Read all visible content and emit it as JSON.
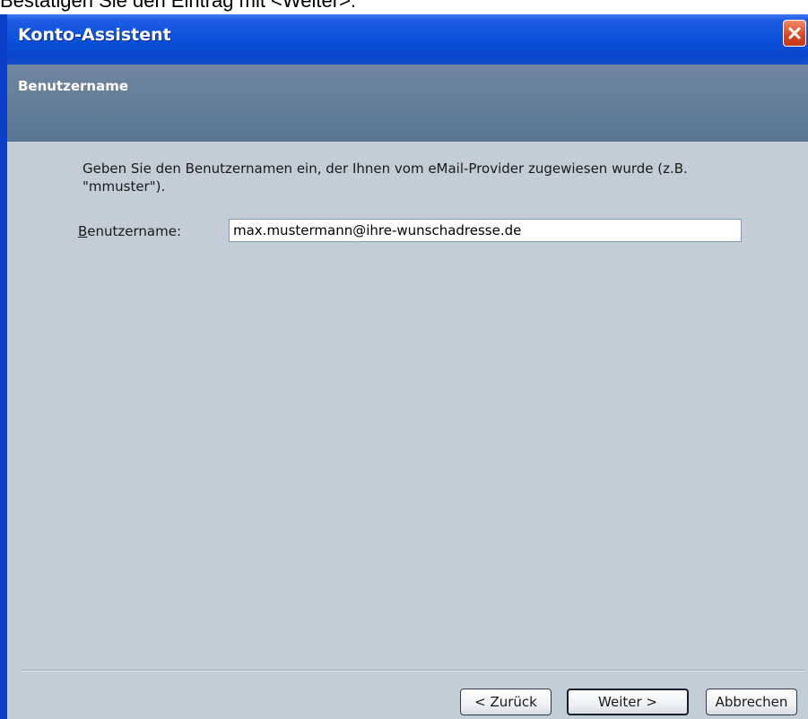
{
  "caption": "Bestätigen Sie den Eintrag mit <Weiter>.",
  "window": {
    "title": "Konto-Assistent"
  },
  "header": {
    "title": "Benutzername"
  },
  "content": {
    "description": "Geben Sie den Benutzernamen ein, der Ihnen vom eMail-Provider zugewiesen wurde (z.B. \"mmuster\").",
    "username_label_accesskey": "B",
    "username_label_rest": "enutzername:",
    "username_value": "max.mustermann@ihre-wunschadresse.de"
  },
  "buttons": {
    "back": "< Zurück",
    "next": "Weiter >",
    "cancel": "Abbrechen"
  },
  "icons": {
    "close": "close-icon"
  },
  "colors": {
    "titlebar": "#0a4fd8",
    "header_panel": "#587590",
    "content_bg": "#c4cdd6",
    "close_button": "#d9461f"
  }
}
